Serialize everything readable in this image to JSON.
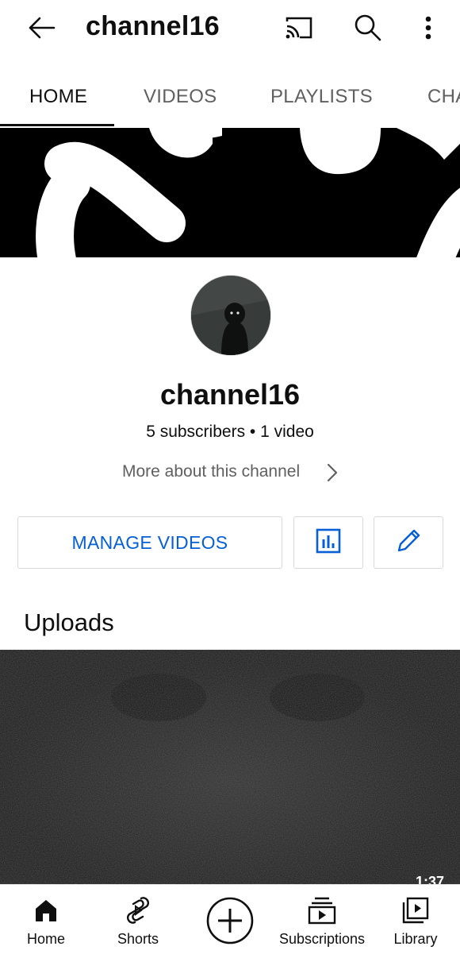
{
  "header": {
    "title": "channel16",
    "back_icon": "arrow-left-icon",
    "cast_icon": "cast-icon",
    "search_icon": "search-icon",
    "more_icon": "more-vertical-icon"
  },
  "tabs": [
    {
      "label": "HOME",
      "active": true
    },
    {
      "label": "VIDEOS",
      "active": false
    },
    {
      "label": "PLAYLISTS",
      "active": false
    },
    {
      "label": "CHA",
      "active": false
    }
  ],
  "channel": {
    "name": "channel16",
    "stats": "5 subscribers • 1 video",
    "more_about": "More about this channel"
  },
  "actions": {
    "manage_videos": "MANAGE VIDEOS",
    "analytics_icon": "analytics-icon",
    "edit_icon": "pencil-icon",
    "accent_color": "#065fd4"
  },
  "uploads": {
    "title": "Uploads",
    "video_duration": "1:37"
  },
  "bottom_nav": [
    {
      "label": "Home",
      "icon": "home-icon"
    },
    {
      "label": "Shorts",
      "icon": "shorts-icon"
    },
    {
      "label": "",
      "icon": "create-plus-icon"
    },
    {
      "label": "Subscriptions",
      "icon": "subscriptions-icon"
    },
    {
      "label": "Library",
      "icon": "library-icon"
    }
  ]
}
